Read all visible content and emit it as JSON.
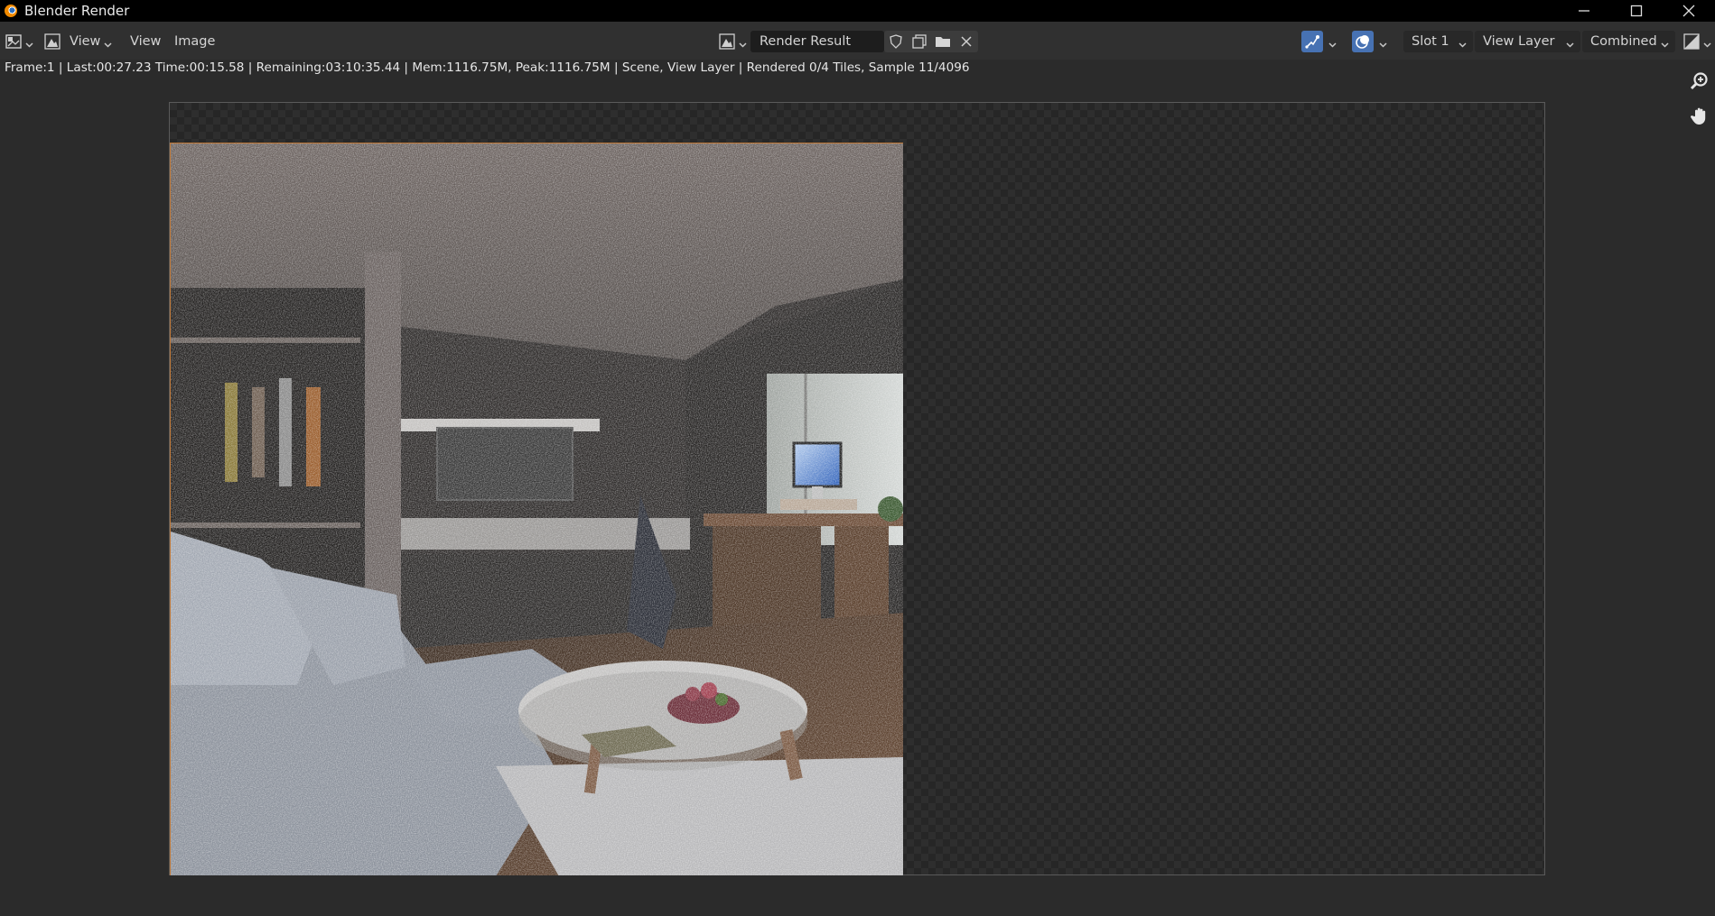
{
  "window": {
    "title": "Blender Render",
    "buttons": [
      "minimize",
      "maximize",
      "close"
    ]
  },
  "header": {
    "menus": [
      "View",
      "View",
      "Image"
    ],
    "image_name": "Render Result",
    "slot": "Slot 1",
    "view_layer": "View Layer",
    "pass": "Combined"
  },
  "status": {
    "text": "Frame:1 | Last:00:27.23 Time:00:15.58 | Remaining:03:10:35.44 | Mem:1116.75M, Peak:1116.75M | Scene, View Layer | Rendered 0/4 Tiles, Sample 11/4096"
  },
  "colors": {
    "accent": "#4772b3",
    "background": "#2b2b2b",
    "header": "#303030"
  },
  "icons": {
    "editor_type": "image-editor-icon",
    "sidebar_view": "image-view-icon",
    "browse_image": "image-browse-icon",
    "fake_user": "shield-icon",
    "new_image": "new-image-icon",
    "open_image": "folder-icon",
    "unlink": "close-icon",
    "gizmo": "gizmo-icon",
    "overlay": "overlay-icon",
    "display_channels": "display-channels-icon",
    "zoom": "zoom-icon",
    "pan": "hand-icon"
  }
}
